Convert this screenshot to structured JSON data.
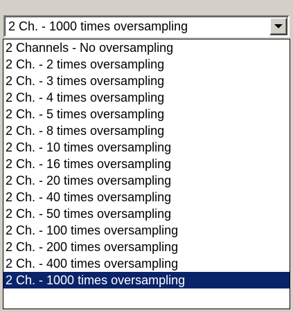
{
  "combo": {
    "selected_value": "2 Ch. - 1000 times oversampling",
    "button_icon": "chevron-down-icon"
  },
  "dropdown": {
    "options": [
      "2 Channels - No oversampling",
      "2 Ch. - 2 times oversampling",
      "2 Ch. - 3 times oversampling",
      "2 Ch. - 4 times oversampling",
      "2 Ch. - 5 times oversampling",
      "2 Ch. - 8 times oversampling",
      "2 Ch. - 10 times oversampling",
      "2 Ch. - 16 times oversampling",
      "2 Ch. - 20 times oversampling",
      "2 Ch. - 40 times oversampling",
      "2 Ch. - 50 times oversampling",
      "2 Ch. - 100 times oversampling",
      "2 Ch. - 200 times oversampling",
      "2 Ch. - 400 times oversampling",
      "2 Ch. - 1000 times oversampling"
    ],
    "selected_index": 14,
    "highlight_color": "#0a246a"
  }
}
